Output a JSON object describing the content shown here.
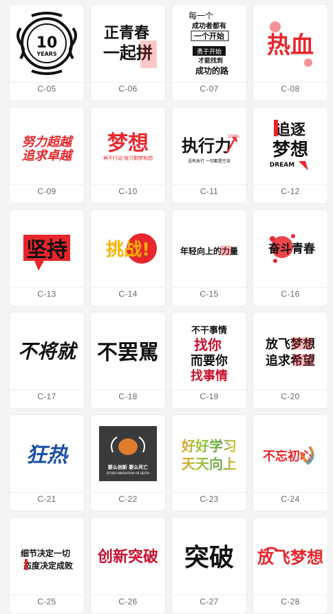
{
  "items": [
    {
      "code": "C-05",
      "art": [
        "10",
        "YEARS"
      ]
    },
    {
      "code": "C-06",
      "art": [
        "正青春",
        "一起拼"
      ]
    },
    {
      "code": "C-07",
      "art": [
        "每一个",
        "成功者都有",
        "一个开始",
        "勇于开始",
        "才能找到",
        "成功的路"
      ]
    },
    {
      "code": "C-08",
      "art": [
        "热血"
      ]
    },
    {
      "code": "C-09",
      "art": [
        "努力超越",
        "追求卓越"
      ]
    },
    {
      "code": "C-10",
      "art": [
        "梦想",
        "再不行动 就只剩梦和想"
      ]
    },
    {
      "code": "C-11",
      "art": [
        "执行力",
        "100%",
        "没有执行  一切都是空谈"
      ]
    },
    {
      "code": "C-12",
      "art": [
        "追逐",
        "梦想",
        "DREAM"
      ]
    },
    {
      "code": "C-13",
      "art": [
        "坚持"
      ]
    },
    {
      "code": "C-14",
      "art": [
        "挑战!"
      ]
    },
    {
      "code": "C-15",
      "art": [
        "年轻向上的力量"
      ]
    },
    {
      "code": "C-16",
      "art": [
        "奋斗青春"
      ]
    },
    {
      "code": "C-17",
      "art": [
        "不将就"
      ]
    },
    {
      "code": "C-18",
      "art": [
        "不罢駡"
      ]
    },
    {
      "code": "C-19",
      "art": [
        "不干事情",
        "找你",
        "而要你",
        "找事情"
      ]
    },
    {
      "code": "C-20",
      "art": [
        "放飞梦想",
        "追求希望"
      ]
    },
    {
      "code": "C-21",
      "art": [
        "狂热"
      ]
    },
    {
      "code": "C-22",
      "art": [
        "要么创新  要么死亡",
        "EITHER INNOVATION OR DEATH"
      ]
    },
    {
      "code": "C-23",
      "art": [
        "好好学习",
        "天天向上"
      ]
    },
    {
      "code": "C-24",
      "art": [
        "不忘初心"
      ]
    },
    {
      "code": "C-25",
      "art": [
        "细节决定一切",
        "态度决定成败"
      ]
    },
    {
      "code": "C-26",
      "art": [
        "创新突破"
      ]
    },
    {
      "code": "C-27",
      "art": [
        "突破"
      ]
    },
    {
      "code": "C-28",
      "art": [
        "放飞梦想"
      ]
    }
  ],
  "colors": {
    "red": "#e8262c",
    "dark": "#111111",
    "blue": "#1d4fa6",
    "caption": "#666666"
  }
}
